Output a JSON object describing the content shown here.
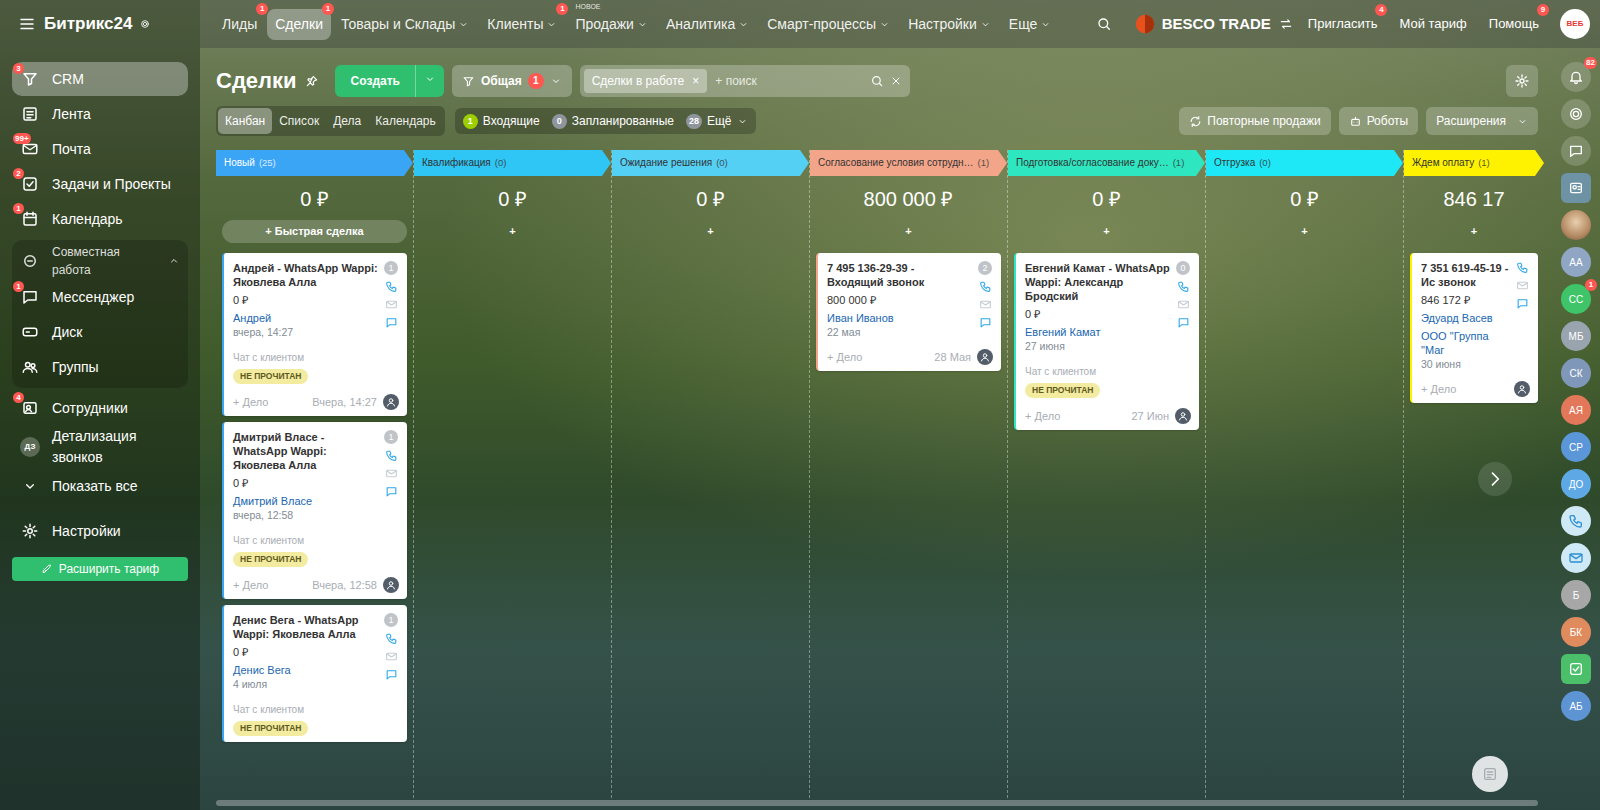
{
  "header": {
    "logo": "Битрикс24",
    "nav": [
      {
        "label": "Лиды",
        "badge": "1",
        "dropdown": false,
        "selected": false
      },
      {
        "label": "Сделки",
        "badge": "1",
        "dropdown": false,
        "selected": true
      },
      {
        "label": "Товары и Склады",
        "dropdown": true,
        "selected": false
      },
      {
        "label": "Клиенты",
        "badge": "1",
        "dropdown": true,
        "selected": false
      },
      {
        "label": "Продажи",
        "tag": "НОВОЕ",
        "dropdown": true,
        "selected": false
      },
      {
        "label": "Аналитика",
        "dropdown": true,
        "selected": false
      },
      {
        "label": "Смарт-процессы",
        "dropdown": true,
        "selected": false
      },
      {
        "label": "Настройки",
        "dropdown": true,
        "selected": false
      },
      {
        "label": "Еще",
        "dropdown": true,
        "selected": false
      }
    ],
    "company": "BESCO TRADE",
    "actions": [
      {
        "label": "Пригласить",
        "badge": "4"
      },
      {
        "label": "Мой тариф"
      },
      {
        "label": "Помощь",
        "badge": "9"
      }
    ],
    "user_badge": "ВЕБ"
  },
  "sidebar": {
    "items": [
      {
        "label": "CRM",
        "badge": "3",
        "selected": true
      },
      {
        "label": "Лента",
        "selected": false
      },
      {
        "label": "Почта",
        "badge": "99+",
        "selected": false
      },
      {
        "label": "Задачи и Проекты",
        "badge": "2",
        "selected": false
      },
      {
        "label": "Календарь",
        "badge": "1",
        "selected": false
      }
    ],
    "group": {
      "label": "Совместная работа",
      "expanded": true,
      "items": [
        {
          "label": "Мессенджер",
          "badge": "1",
          "selected": false
        },
        {
          "label": "Диск",
          "selected": false
        },
        {
          "label": "Группы",
          "selected": false
        }
      ]
    },
    "more": [
      {
        "label": "Сотрудники",
        "badge": "4",
        "selected": false
      },
      {
        "label": "Детализация звонков",
        "initials": "ДЗ",
        "selected": false
      }
    ],
    "show_all": "Показать все",
    "settings": "Настройки",
    "upgrade": "Расширить тариф"
  },
  "page": {
    "title": "Сделки",
    "create": "Создать",
    "category": {
      "label": "Общая",
      "badge": "1"
    },
    "filter": {
      "chip": "Сделки в работе",
      "chip_close": "×",
      "placeholder": "+ поиск"
    },
    "views": [
      {
        "label": "Канбан",
        "selected": true
      },
      {
        "label": "Список",
        "selected": false
      },
      {
        "label": "Дела",
        "selected": false
      },
      {
        "label": "Календарь",
        "selected": false
      }
    ],
    "counters": [
      {
        "count": "1",
        "label": "Входящие",
        "color": "#9dcf00",
        "dropdown": false
      },
      {
        "count": "0",
        "label": "Запланированные",
        "color": "#8f959c",
        "dropdown": false
      },
      {
        "count": "28",
        "label": "Ещё",
        "color": "#8f959c",
        "dropdown": true
      }
    ],
    "tools": [
      {
        "label": "Повторные продажи",
        "dropdown": false
      },
      {
        "label": "Роботы",
        "dropdown": false
      },
      {
        "label": "Расширения",
        "dropdown": true
      }
    ]
  },
  "board": {
    "columns": [
      {
        "name": "Новый",
        "count": "(25)",
        "color": "#3ba5f5",
        "total": "0 ₽",
        "add": "+ Быстрая сделка",
        "cards": [
          {
            "title": "Андрей - WhatsApp Wappi: Яковлева Алла",
            "counter": "1",
            "amount": "0 ₽",
            "contact": "Андрей",
            "date": "вчера, 14:27",
            "activity": "Чат с клиентом",
            "status": "НЕ ПРОЧИТАН",
            "add": "+ Дело",
            "deadline": "Вчера, 14:27"
          },
          {
            "title": "Дмитрий Власе - WhatsApp Wappi: Яковлева Алла",
            "counter": "1",
            "amount": "0 ₽",
            "contact": "Дмитрий Власе",
            "date": "вчера, 12:58",
            "activity": "Чат с клиентом",
            "status": "НЕ ПРОЧИТАН",
            "add": "+ Дело",
            "deadline": "Вчера, 12:58"
          },
          {
            "title": "Денис Вега - WhatsApp Wappi: Яковлева Алла",
            "counter": "1",
            "amount": "0 ₽",
            "contact": "Денис Вега",
            "date": "4 июля",
            "activity": "Чат с клиентом",
            "status": "НЕ ПРОЧИТАН"
          }
        ]
      },
      {
        "name": "Квалификация",
        "count": "(0)",
        "color": "#2fc6f6",
        "total": "0 ₽",
        "add": "+",
        "cards": []
      },
      {
        "name": "Ожидание решения",
        "count": "(0)",
        "color": "#55d0f5",
        "total": "0 ₽",
        "add": "+",
        "cards": []
      },
      {
        "name": "Согласование условия сотрудн…",
        "count": "(1)",
        "color": "#f3a58a",
        "total": "800 000 ₽",
        "add": "+",
        "cards": [
          {
            "title": "7 495 136-29-39 - Входящий звонок",
            "counter": "2",
            "amount": "800 000 ₽",
            "contact": "Иван Иванов",
            "date": "22 мая",
            "add": "+ Дело",
            "deadline": "28 Мая"
          }
        ]
      },
      {
        "name": "Подготовка/согласование доку…",
        "count": "(1)",
        "color": "#2ee6c0",
        "total": "0 ₽",
        "add": "+",
        "cards": [
          {
            "title": "Евгений Камат - WhatsApp Wappi: Александр Бродский",
            "counter": "0",
            "amount": "0 ₽",
            "contact": "Евгений Камат",
            "date": "27 июня",
            "activity": "Чат с клиентом",
            "status": "НЕ ПРОЧИТАН",
            "add": "+ Дело",
            "deadline": "27 Июн"
          }
        ]
      },
      {
        "name": "Отгрузка",
        "count": "(0)",
        "color": "#1ee8f5",
        "total": "0 ₽",
        "add": "+",
        "cards": []
      },
      {
        "name": "Ждем оплату",
        "count": "(1)",
        "color": "#fff200",
        "total": "846 17",
        "add": "+",
        "cards": [
          {
            "title": "7 351 619-45-19 - Ис звонок",
            "amount": "846 172 ₽",
            "contact": "Эдуард Васев",
            "company": "ООО \"Группа \"Маг",
            "date": "30 июня",
            "add": "+ Дело"
          }
        ]
      }
    ]
  },
  "rail": {
    "items": [
      {
        "kind": "bell",
        "badge": "82"
      },
      {
        "kind": "target"
      },
      {
        "kind": "chat"
      },
      {
        "kind": "contacts"
      },
      {
        "kind": "photo"
      },
      {
        "kind": "avatar",
        "initials": "АА",
        "color": "#8fa6c4"
      },
      {
        "kind": "avatar",
        "initials": "СС",
        "color": "#3fc46a",
        "badge": "1"
      },
      {
        "kind": "avatar",
        "initials": "МБ",
        "color": "#9aa4ae"
      },
      {
        "kind": "avatar",
        "initials": "СК",
        "color": "#7f98b9"
      },
      {
        "kind": "avatar",
        "initials": "АЯ",
        "color": "#e2775a"
      },
      {
        "kind": "avatar",
        "initials": "СР",
        "color": "#5b96d8"
      },
      {
        "kind": "avatar",
        "initials": "ДО",
        "color": "#5ea9e5"
      },
      {
        "kind": "phone"
      },
      {
        "kind": "mail"
      },
      {
        "kind": "avatar",
        "initials": "Б",
        "color": "#a7a7a7"
      },
      {
        "kind": "avatar",
        "initials": "БК",
        "color": "#e08b5d"
      },
      {
        "kind": "task"
      },
      {
        "kind": "avatar",
        "initials": "АБ",
        "color": "#5c94d4"
      }
    ]
  }
}
